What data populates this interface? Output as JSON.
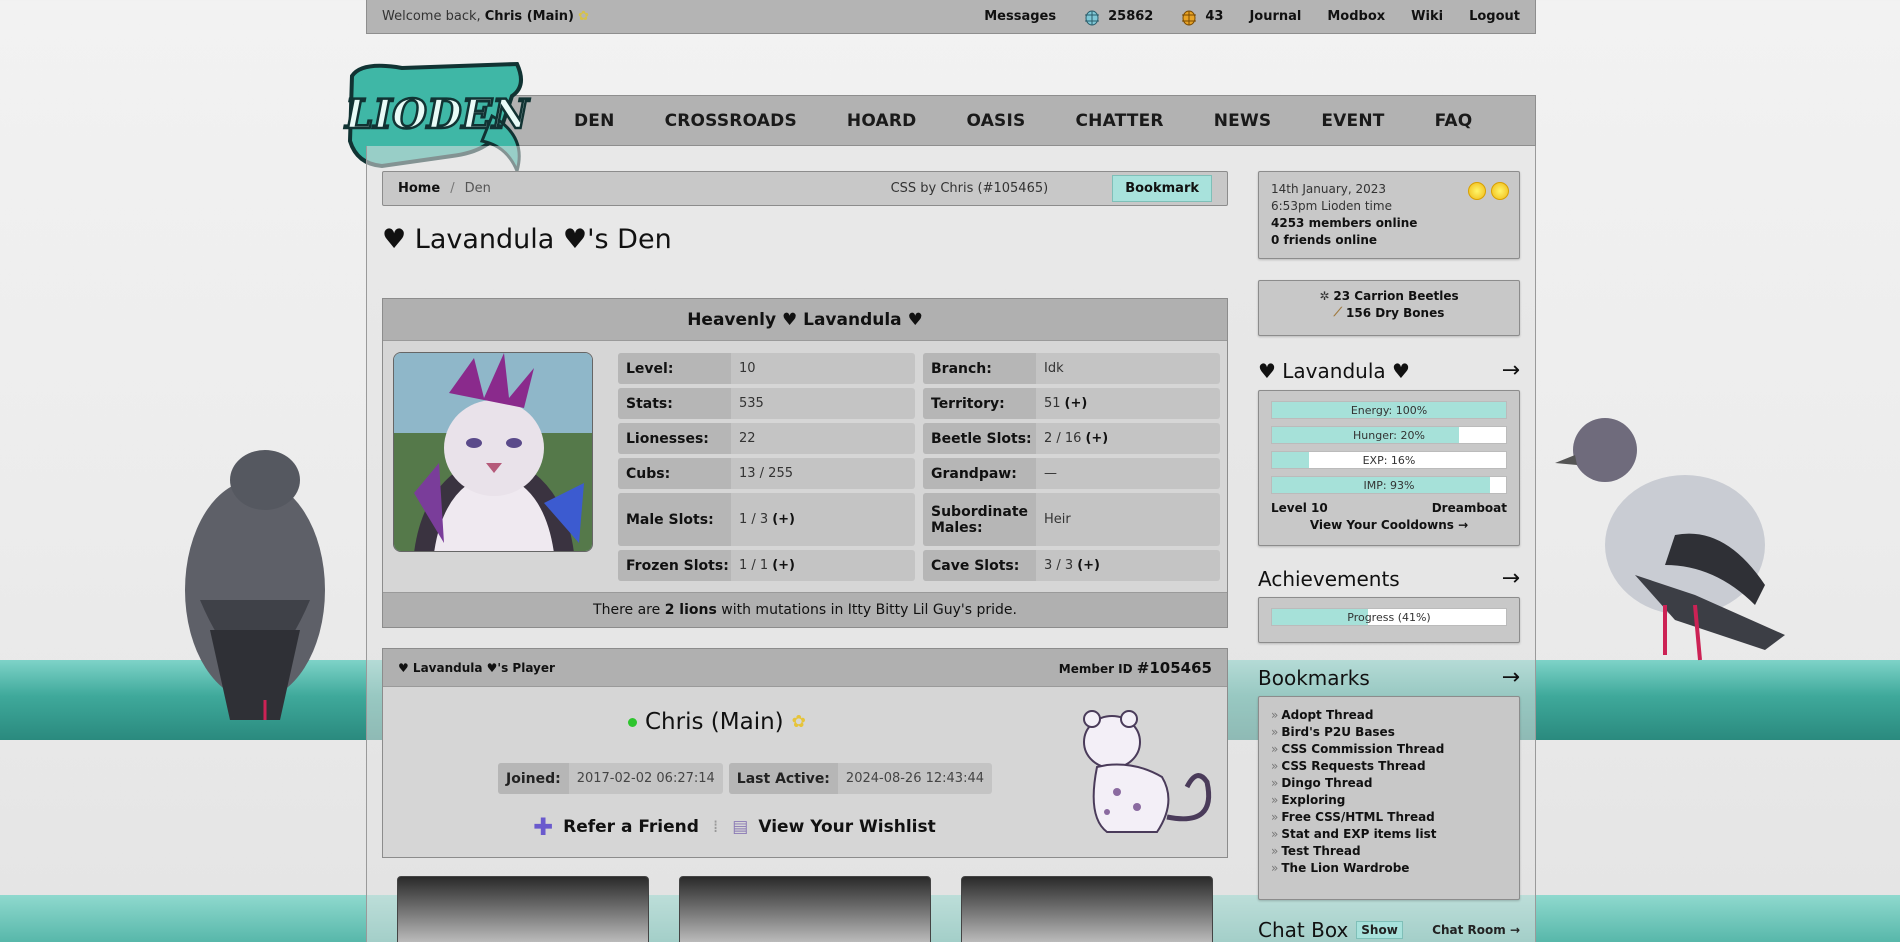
{
  "topbar": {
    "welcome_prefix": "Welcome back,",
    "username": "Chris (Main)",
    "messages": "Messages",
    "beetles": "25862",
    "gold": "43",
    "journal": "Journal",
    "modbox": "Modbox",
    "wiki": "Wiki",
    "logout": "Logout"
  },
  "logo_text": "LIODEN",
  "nav": [
    "DEN",
    "CROSSROADS",
    "HOARD",
    "OASIS",
    "CHATTER",
    "NEWS",
    "EVENT",
    "FAQ"
  ],
  "breadcrumb": {
    "home": "Home",
    "separator": "/",
    "current": "Den",
    "css_credit": "CSS by Chris (#105465)",
    "bookmark": "Bookmark"
  },
  "page_title": "♥ Lavandula ♥'s Den",
  "lion": {
    "name": "Heavenly ♥ Lavandula ♥",
    "stats": [
      {
        "label": "Level:",
        "value": "10",
        "plus": "",
        "label2": "Branch:",
        "value2": "Idk",
        "plus2": ""
      },
      {
        "label": "Stats:",
        "value": "535",
        "plus": "",
        "label2": "Territory:",
        "value2": "51",
        "plus2": "(+)"
      },
      {
        "label": "Lionesses:",
        "value": "22",
        "plus": "",
        "label2": "Beetle Slots:",
        "value2": "2 / 16",
        "plus2": "(+)"
      },
      {
        "label": "Cubs:",
        "value": "13 / 255",
        "plus": "",
        "label2": "Grandpaw:",
        "value2": "—",
        "plus2": ""
      },
      {
        "label": "Male Slots:",
        "value": "1 / 3",
        "plus": "(+)",
        "label2": "Subordinate Males:",
        "value2": "Heir",
        "plus2": ""
      },
      {
        "label": "Frozen Slots:",
        "value": "1 / 1",
        "plus": "(+)",
        "label2": "Cave Slots:",
        "value2": "3 / 3",
        "plus2": "(+)"
      }
    ],
    "mutations_pre": "There are",
    "mutations_count": "2 lions",
    "mutations_post": "with mutations in Itty Bitty Lil Guy's pride."
  },
  "player": {
    "heading": "♥ Lavandula ♥'s Player",
    "member_id_label": "Member ID",
    "member_id": "#105465",
    "name": "Chris (Main)",
    "joined_label": "Joined:",
    "joined": "2017-02-02 06:27:14",
    "active_label": "Last Active:",
    "active": "2024-08-26 12:43:44",
    "refer": "Refer a Friend",
    "sep": "⁞",
    "wishlist": "View Your Wishlist"
  },
  "side": {
    "date": "14th January, 2023",
    "time": "6:53pm Lioden time",
    "members": "4253 members online",
    "friends": "0 friends online",
    "items": [
      "23 Carrion Beetles",
      "156 Dry Bones"
    ],
    "lion_name": "♥ Lavandula ♥",
    "arrow": "→",
    "bars": [
      {
        "label": "Energy: 100%",
        "pct": 100
      },
      {
        "label": "Hunger: 20%",
        "pct": 80
      },
      {
        "label": "EXP: 16%",
        "pct": 16
      },
      {
        "label": "IMP: 93%",
        "pct": 93
      }
    ],
    "level": "Level 10",
    "title": "Dreamboat",
    "cooldowns": "View Your Cooldowns →",
    "achievements": "Achievements",
    "progress_label": "Progress (41%)",
    "progress_pct": 41,
    "bookmarks_title": "Bookmarks",
    "bookmarks": [
      "Adopt Thread",
      "Bird's P2U Bases",
      "CSS Commission Thread",
      "CSS Requests Thread",
      "Dingo Thread",
      "Exploring",
      "Free CSS/HTML Thread",
      "Stat and EXP items list",
      "Test Thread",
      "The Lion Wardrobe"
    ],
    "bullet": "»",
    "chat_title": "Chat Box",
    "chat_show": "Show",
    "chat_room": "Chat Room →"
  },
  "colors": {
    "accent": "#a8e2dc",
    "online": "#2ec52e",
    "panel": "#d6d6d6",
    "header": "#b0b0b0"
  }
}
